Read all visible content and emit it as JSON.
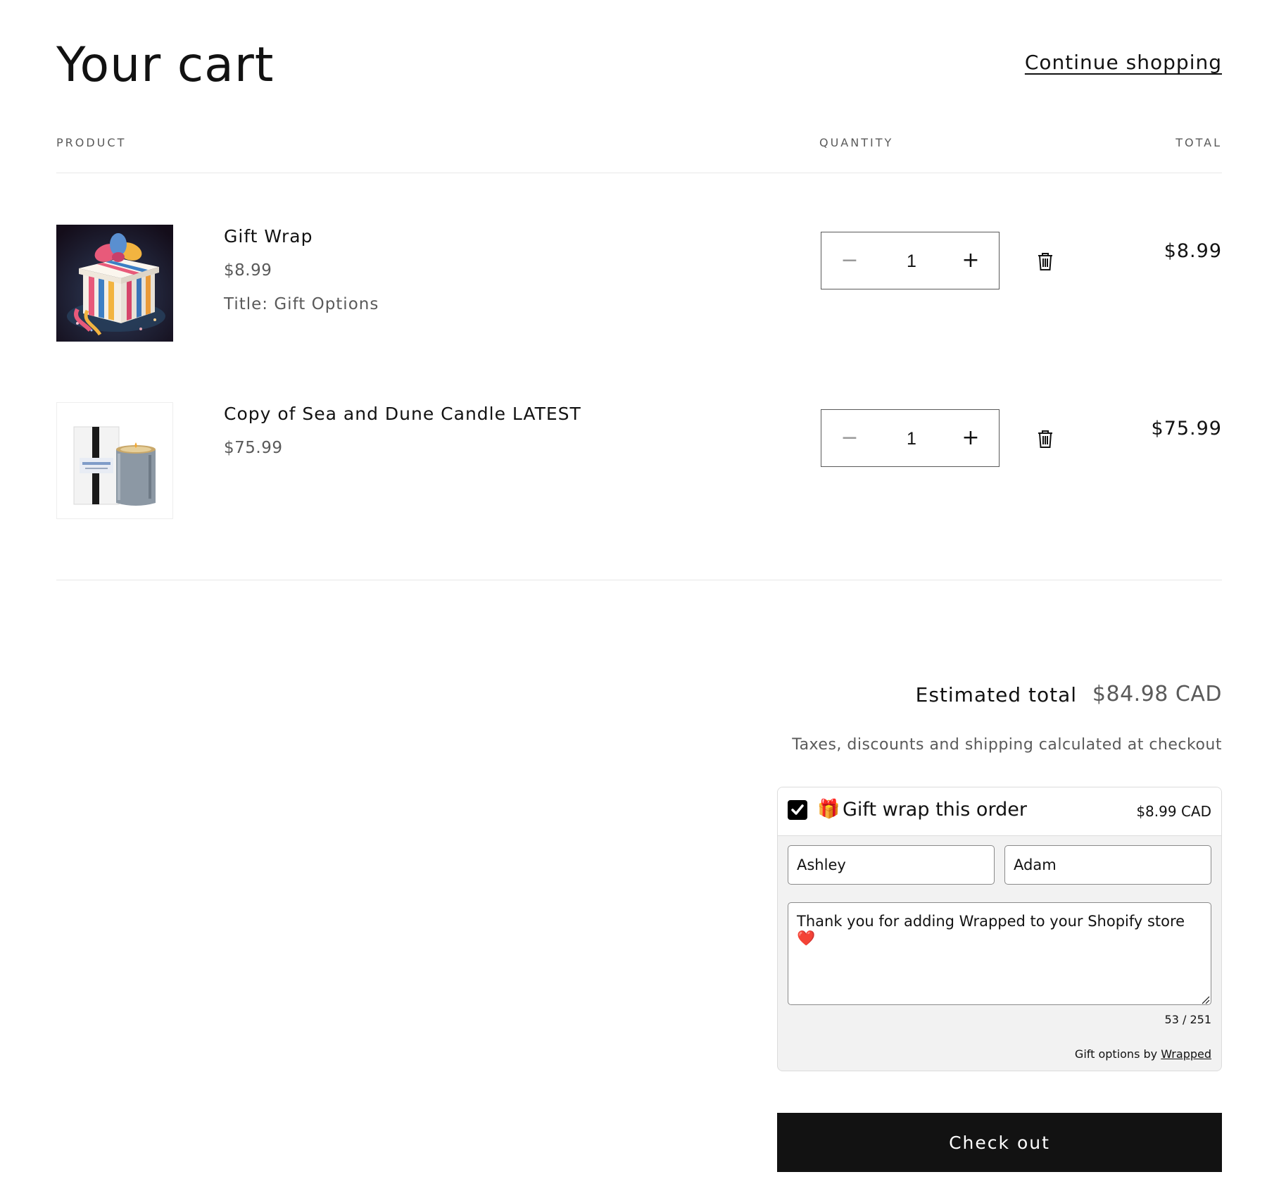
{
  "header": {
    "title": "Your cart",
    "continue_label": "Continue shopping"
  },
  "columns": {
    "product": "PRODUCT",
    "quantity": "QUANTITY",
    "total": "TOTAL"
  },
  "items": [
    {
      "name": "Gift Wrap",
      "price": "$8.99",
      "option": "Title: Gift Options",
      "quantity": "1",
      "line_total": "$8.99",
      "image": "gift-box-image"
    },
    {
      "name": "Copy of Sea and Dune Candle LATEST",
      "price": "$75.99",
      "quantity": "1",
      "line_total": "$75.99",
      "image": "candle-image"
    }
  ],
  "controls": {
    "minus_symbol": "−",
    "plus_symbol": "+",
    "remove_icon": "trash-icon"
  },
  "summary": {
    "estimated_label": "Estimated total",
    "estimated_value": "$84.98 CAD",
    "tax_note": "Taxes, discounts and shipping calculated at checkout"
  },
  "gift": {
    "checked": true,
    "emoji": "🎁",
    "title": "Gift wrap this order",
    "price": "$8.99 CAD",
    "from_value": "Ashley",
    "to_value": "Adam",
    "message": "Thank you for adding Wrapped to your Shopify store ❤️",
    "char_count": "53 / 251",
    "powered_prefix": "Gift options by ",
    "powered_link": "Wrapped"
  },
  "checkout": {
    "label": "Check out"
  },
  "colors": {
    "text": "#121212",
    "muted": "#5a5a5a",
    "button_bg": "#121212",
    "panel_bg": "#f2f2f2"
  }
}
